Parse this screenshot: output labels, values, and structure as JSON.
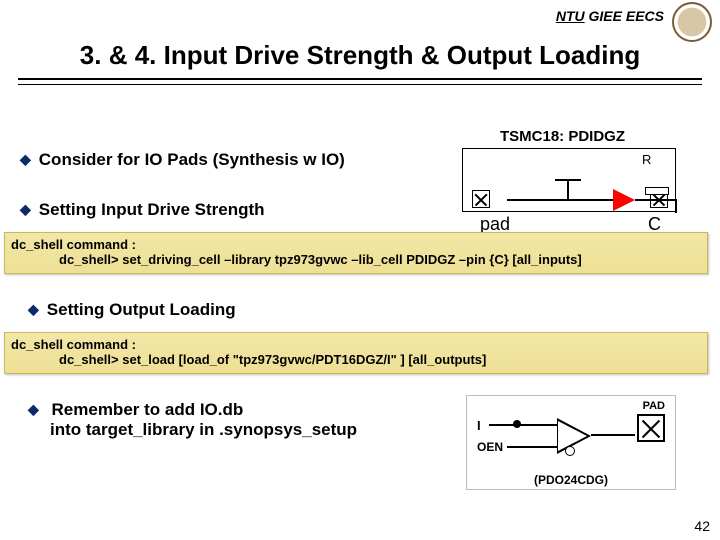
{
  "header": {
    "org": "NTU",
    "dept": "GIEE EECS"
  },
  "title": "3. & 4. Input Drive Strength & Output Loading",
  "bullets": {
    "b1": "Consider for IO Pads (Synthesis w IO)",
    "b2": "Setting Input Drive Strength",
    "b3": "Setting Output Loading",
    "b4a": "Remember to add IO.db",
    "b4b": "into target_library in .synopsys_setup"
  },
  "code1": {
    "hdr": "dc_shell command :",
    "cmd": "dc_shell> set_driving_cell –library tpz973gvwc –lib_cell PDIDGZ –pin {C} [all_inputs]"
  },
  "code2": {
    "hdr": "dc_shell command :",
    "cmd": "dc_shell> set_load [load_of \"tpz973gvwc/PDT16DGZ/I\" ] [all_outputs]"
  },
  "diag1": {
    "title": "TSMC18: PDIDGZ",
    "r": "R",
    "pad": "pad",
    "c": "C"
  },
  "diag2": {
    "pad": "PAD",
    "i": "I",
    "oen": "OEN",
    "name": "(PDO24CDG)"
  },
  "page": "42"
}
